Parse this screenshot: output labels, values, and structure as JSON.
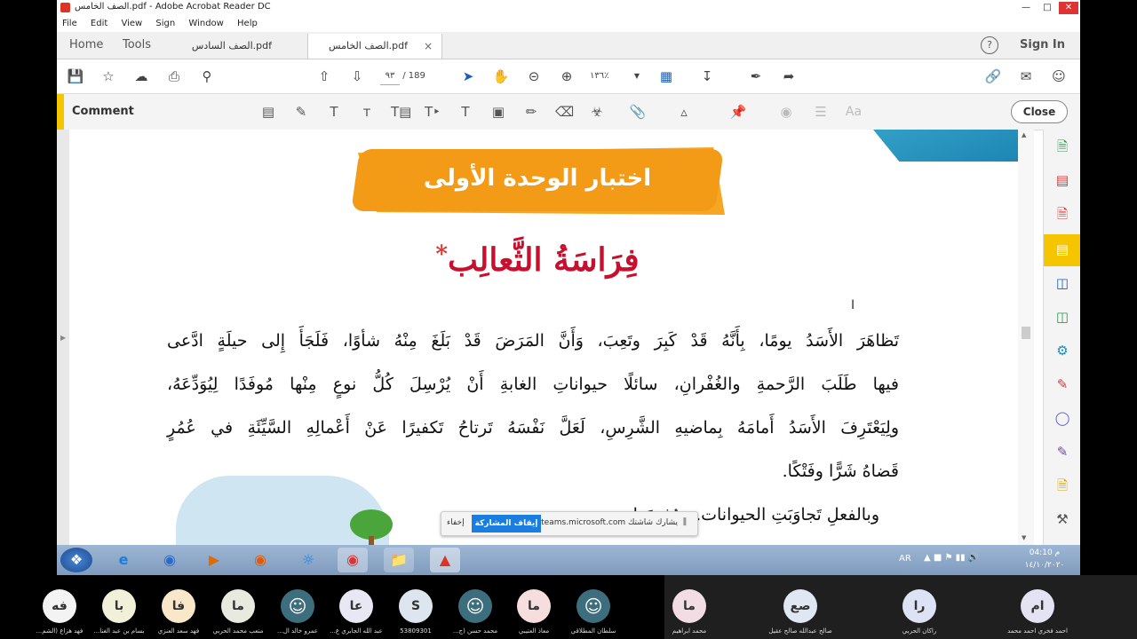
{
  "window": {
    "title": "الصف الخامس.pdf - Adobe Acrobat Reader DC"
  },
  "menu": [
    "File",
    "Edit",
    "View",
    "Sign",
    "Window",
    "Help"
  ],
  "nav": {
    "home": "Home",
    "tools": "Tools",
    "sign_in": "Sign In"
  },
  "tabs": [
    {
      "label": "الصف السادس.pdf",
      "active": false
    },
    {
      "label": "الصف الخامس.pdf",
      "active": true,
      "close": "×"
    }
  ],
  "toolbar": {
    "page_current": "٩٣",
    "page_sep": "/",
    "page_total": "189",
    "zoom": "١٣٦٪"
  },
  "comment_bar": {
    "label": "Comment",
    "close": "Close"
  },
  "document": {
    "unit_title": "اختبار الوحدة الأولى",
    "story_title": "فِرَاسَةُ الثَّعالِب",
    "star": "*",
    "paragraph1": [
      "تَظاهَرَ الأَسَدُ يومًا، بِأَنَّهُ قَدْ كَبِرَ وتَعِبَ، وَأَنَّ المَرَضَ قَدْ بَلَغَ مِنْهُ شأوًا، فَلَجَأَ إِلى حيلَةٍ ادَّعى",
      "فيها طَلَبَ الرَّحمةِ والغُفْرانِ، سائلًا حيواناتِ الغابةِ أَنْ يُرْسِلَ كُلُّ نوعٍ مِنْها مُوفَدًا لِيُوَدِّعَهُ،",
      "ولِيَعْتَرِفَ الأَسَدُ أَمامَهُ بِماضيهِ الشَّرِسِ، لَعَلَّ نَفْسَهُ تَرتاحُ تَكفيرًا عَنْ أَعْمالِهِ السَّيِّئَةِ في عُمُرٍ",
      "قَضاهُ شَرًّا وفَتْكًا."
    ],
    "paragraph2_start": "وبالفعلِ تَجاوَبَتِ الحيوانات... وُفودَها"
  },
  "share_banner": {
    "text": "يشارك شاشتك teams.microsoft.com",
    "stop": "إيقاف المشاركة",
    "hide": "إخفاء"
  },
  "taskbar": {
    "lang": "AR",
    "time": "04:10 م",
    "date": "١٤/١٠/٢٠٢٠"
  },
  "participants": [
    {
      "initials": "فه",
      "name": "...فهد هزاع (الشم",
      "color": "#f3f3f3"
    },
    {
      "initials": "با",
      "name": "...بسام بن عبد الغنا",
      "color": "#f1f0d8"
    },
    {
      "initials": "فا",
      "name": "فهد سعد العنزي",
      "color": "#f8e7c8"
    },
    {
      "initials": "ما",
      "name": "متعب محمد الحربي",
      "color": "#e9eadf"
    },
    {
      "initials": "",
      "name": "...عمرو خالد ال",
      "color": "#3d6e7e",
      "icon": "user-icon"
    },
    {
      "initials": "عا",
      "name": "...عبد الله الجابري ع",
      "color": "#e7e8f3"
    },
    {
      "initials": "S",
      "name": "53809301",
      "color": "#dde5ee"
    },
    {
      "initials": "",
      "name": "...محمد حسن (ج",
      "color": "#3d6e7e",
      "icon": "user-icon"
    },
    {
      "initials": "ما",
      "name": "معاذ العتيبي",
      "color": "#f7dede"
    },
    {
      "initials": "",
      "name": "سلطان المطلاقي",
      "color": "#3d6e7e",
      "icon": "user-icon"
    },
    {
      "initials": "ما",
      "name": "محمد ابراهيم",
      "color": "#f2dde4"
    },
    {
      "initials": "صع",
      "name": "صالح عبدالله صالح عقيل",
      "color": "#dfe7f2"
    },
    {
      "initials": "را",
      "name": "راكان الحربي",
      "color": "#dde3f4"
    },
    {
      "initials": "ام",
      "name": "احمد فخري احمد محمد",
      "color": "#e3e3f3"
    }
  ]
}
